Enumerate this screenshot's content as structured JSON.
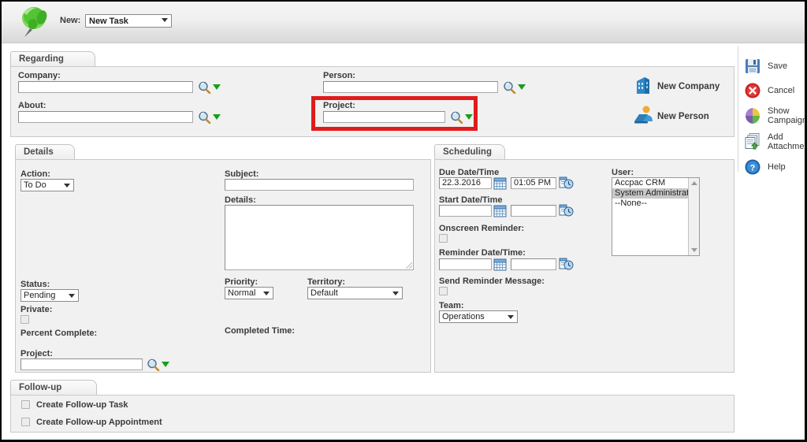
{
  "topbar": {
    "pin_icon": "green-pushpin-icon",
    "new_label": "New:",
    "new_value": "New Task",
    "new_options": [
      "New Task"
    ]
  },
  "regarding": {
    "tab_label": "Regarding",
    "company_label": "Company:",
    "company_value": "",
    "about_label": "About:",
    "about_value": "",
    "person_label": "Person:",
    "person_value": "",
    "project_label": "Project:",
    "project_value": "",
    "new_company_label": "New Company",
    "new_person_label": "New Person"
  },
  "details": {
    "tab_label": "Details",
    "action_label": "Action:",
    "action_value": "To Do",
    "status_label": "Status:",
    "status_value": "Pending",
    "private_label": "Private:",
    "private_checked": false,
    "percent_complete_label": "Percent Complete:",
    "percent_complete_value": "",
    "project_label": "Project:",
    "project_value": "",
    "subject_label": "Subject:",
    "subject_value": "",
    "details_label": "Details:",
    "details_value": "",
    "priority_label": "Priority:",
    "priority_value": "Normal",
    "territory_label": "Territory:",
    "territory_value": "Default",
    "completed_time_label": "Completed Time:",
    "completed_time_value": ""
  },
  "scheduling": {
    "tab_label": "Scheduling",
    "due_label": "Due Date/Time",
    "due_date": "22.3.2016",
    "due_time": "01:05 PM",
    "start_label": "Start Date/Time",
    "start_date": "",
    "start_time": "",
    "onscreen_reminder_label": "Onscreen Reminder:",
    "onscreen_reminder_checked": false,
    "reminder_label": "Reminder Date/Time:",
    "reminder_date": "",
    "reminder_time": "",
    "send_reminder_label": "Send Reminder Message:",
    "send_reminder_checked": false,
    "team_label": "Team:",
    "team_value": "Operations",
    "user_label": "User:",
    "users": [
      {
        "label": "Accpac CRM",
        "selected": false
      },
      {
        "label": "System Administrator",
        "selected": true
      },
      {
        "label": "--None--",
        "selected": false
      }
    ]
  },
  "followup": {
    "tab_label": "Follow-up",
    "create_task_label": "Create Follow-up Task",
    "create_task_checked": false,
    "create_appt_label": "Create Follow-up Appointment",
    "create_appt_checked": false
  },
  "sidebar": {
    "items": [
      {
        "label": "Save",
        "icon": "save-disk-icon"
      },
      {
        "label": "Cancel",
        "icon": "cancel-icon"
      },
      {
        "label": "Show Campaigns",
        "icon": "pie-chart-icon"
      },
      {
        "label": "Add Attachment",
        "icon": "attachment-icon"
      },
      {
        "label": "Help",
        "icon": "help-icon"
      }
    ]
  },
  "highlight": {
    "color": "#e01b1b",
    "target": "project-lookup-field"
  }
}
